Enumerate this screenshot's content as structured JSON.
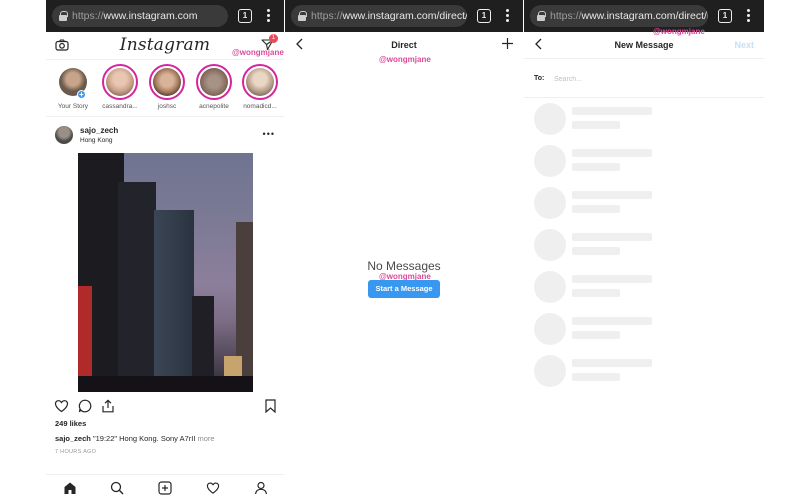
{
  "browser": {
    "panels": [
      {
        "url_scheme": "https://",
        "url_rest": "www.instagram.com",
        "tab_count": "1"
      },
      {
        "url_scheme": "https://",
        "url_rest": "www.instagram.com/direct/i",
        "tab_count": "1"
      },
      {
        "url_scheme": "https://",
        "url_rest": "www.instagram.com/direct/n",
        "tab_count": "1"
      }
    ]
  },
  "watermark": "@wongmjane",
  "feed": {
    "logo": "Instagram",
    "notification_count": "1",
    "stories": [
      {
        "label": "Your Story",
        "face": "#6b5a4c"
      },
      {
        "label": "cassandra...",
        "face": "#c9a18a"
      },
      {
        "label": "joshsc",
        "face": "#a57b5e"
      },
      {
        "label": "acnepolite",
        "face": "#8a6f63"
      },
      {
        "label": "nomadicd...",
        "face": "#b9a28e"
      }
    ],
    "post": {
      "username": "sajo_zech",
      "location": "Hong Kong",
      "more_icon": "•••",
      "likes": "249 likes",
      "caption_user": "sajo_zech",
      "caption_text": " \"19:22\" Hong Kong. Sony A7rII ",
      "caption_more": "more",
      "time": "7 HOURS AGO"
    }
  },
  "direct": {
    "title": "Direct",
    "empty_text": "No Messages",
    "start_button": "Start a Message"
  },
  "new_message": {
    "title": "New Message",
    "next_label": "Next",
    "to_label": "To:",
    "search_placeholder": "Search..."
  },
  "colors": {
    "accent_blue": "#3897f0",
    "story_ring": "#d6249f",
    "notification": "#ed4956",
    "watermark": "#e0489a"
  }
}
